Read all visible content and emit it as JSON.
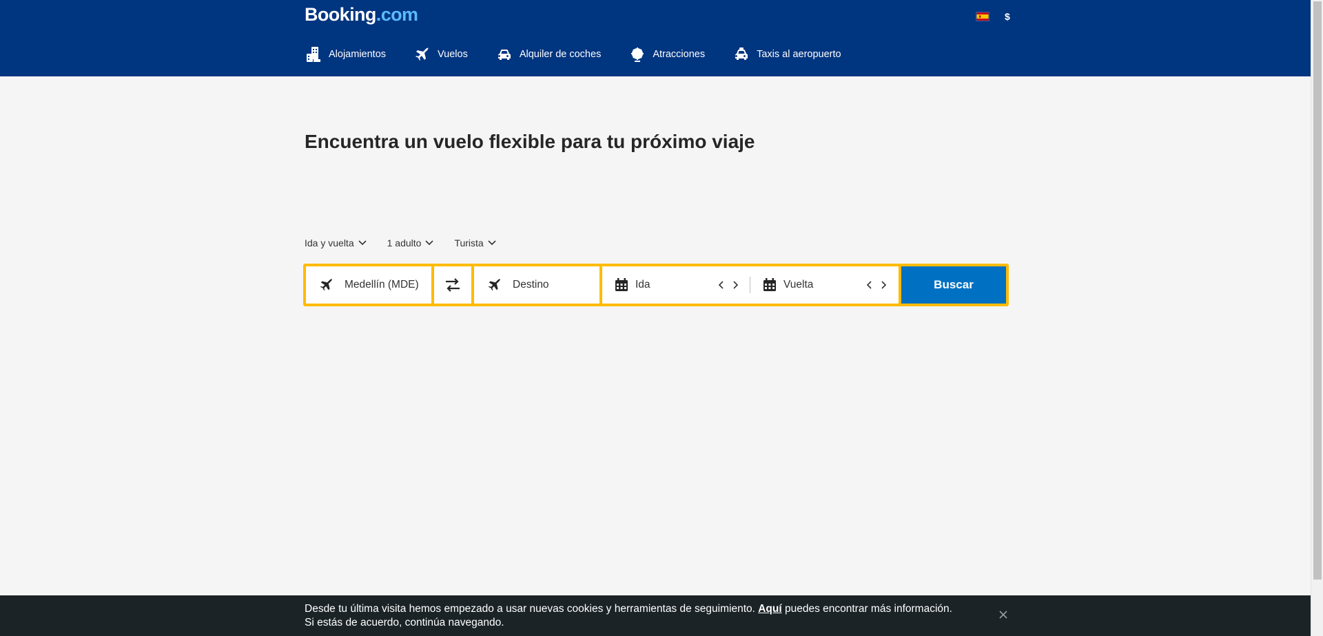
{
  "header": {
    "logo_main": "Booking",
    "logo_suffix": ".com",
    "currency": "$",
    "nav": [
      {
        "label": "Alojamientos",
        "icon": "bed-icon"
      },
      {
        "label": "Vuelos",
        "icon": "plane-icon"
      },
      {
        "label": "Alquiler de coches",
        "icon": "car-icon"
      },
      {
        "label": "Atracciones",
        "icon": "ferris-wheel-icon"
      },
      {
        "label": "Taxis al aeropuerto",
        "icon": "taxi-icon"
      }
    ]
  },
  "main": {
    "headline": "Encuentra un vuelo flexible para tu próximo viaje",
    "options": {
      "trip_type": "Ida y vuelta",
      "travellers": "1 adulto",
      "cabin_class": "Turista"
    },
    "search": {
      "origin": "Medellín (MDE)",
      "destination": "Destino",
      "depart": "Ida",
      "return": "Vuelta",
      "button": "Buscar"
    }
  },
  "cookie": {
    "text_before": "Desde tu última visita hemos empezado a usar nuevas cookies y herramientas de seguimiento. ",
    "link": "Aquí",
    "text_after": " puedes encontrar más información.",
    "line2": "Si estás de acuerdo, continúa navegando."
  },
  "colors": {
    "header_bg": "#003580",
    "search_border": "#febb02",
    "search_button": "#0071c2",
    "cookie_bg": "#1b2327",
    "page_bg": "#f5f5f5"
  }
}
